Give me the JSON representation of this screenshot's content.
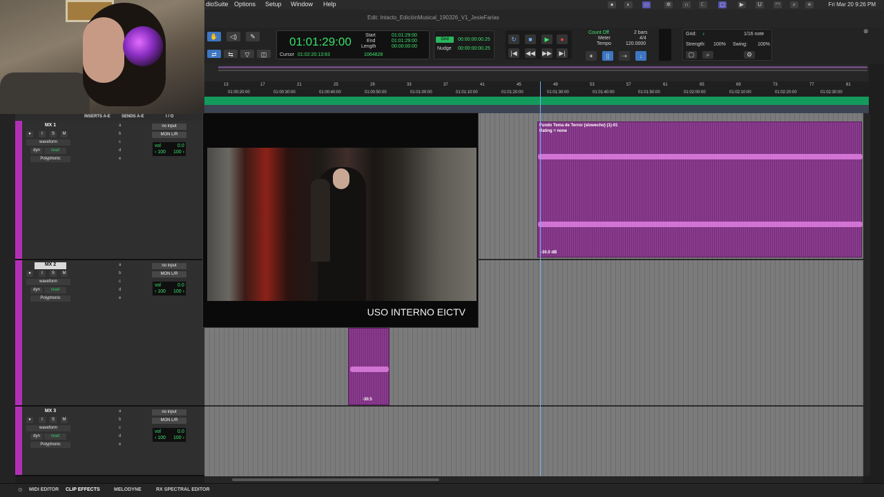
{
  "menubar": {
    "items": [
      "dioSuite",
      "Options",
      "Setup",
      "Window",
      "Help"
    ],
    "clock": "Fri Mar 20  9:26 PM"
  },
  "window": {
    "title": "Edit: Intacto_EdiciónMusical_190326_V1_JesieFarias"
  },
  "counter": {
    "main": "01:01:29:00",
    "start_label": "Start",
    "end_label": "End",
    "length_label": "Length",
    "start": "01:01:29:00",
    "end": "01:01:29:00",
    "length": "00:00:00:00",
    "cursor_label": "Cursor",
    "cursor": "01:02:20:13:93",
    "samples": "1064828",
    "grid_label": "Grid",
    "grid_value": "00:00:00:00.25",
    "nudge_label": "Nudge",
    "nudge_value": "00:00:00:00.25"
  },
  "count": {
    "count_off": "Count Off",
    "meter_label": "Meter",
    "tempo_label": "Tempo",
    "bars": "2 bars",
    "meter": "4/4",
    "tempo": "120.0000"
  },
  "gridpanel": {
    "grid_label": "Grid:",
    "grid_note": "1/16 note",
    "strength_label": "Strength:",
    "strength": "100%",
    "swing_label": "Swing:",
    "swing": "100%"
  },
  "ruler": {
    "bars": [
      "13",
      "17",
      "21",
      "25",
      "29",
      "33",
      "37",
      "41",
      "45",
      "49",
      "53",
      "57",
      "61",
      "65",
      "69",
      "73",
      "77",
      "81"
    ],
    "timecodes": [
      "01:00:20:00",
      "01:00:30:00",
      "01:00:40:00",
      "01:00:50:00",
      "01:01:00:00",
      "01:01:10:00",
      "01:01:20:00",
      "01:01:30:00",
      "01:01:40:00",
      "01:01:50:00",
      "01:02:00:00",
      "01:02:10:00",
      "01:02:20:00",
      "01:02:30:00"
    ]
  },
  "mixer_header": {
    "inserts": "INSERTS A-E",
    "sends": "SENDS A-E",
    "io": "I / O"
  },
  "tracks": [
    {
      "name": "MX 1",
      "view": "waveform",
      "dyn": "dyn",
      "mode": "read",
      "voice": "Polyphonic",
      "input": "no input",
      "output": "MON L/R",
      "vol_label": "vol",
      "vol": "0.0",
      "pan_l": "‹ 100",
      "pan_r": "100 ›"
    },
    {
      "name": "MX 2",
      "view": "waveform",
      "dyn": "dyn",
      "mode": "read",
      "voice": "Polyphonic",
      "input": "no input",
      "output": "MON L/R",
      "vol_label": "vol",
      "vol": "0.0",
      "pan_l": "‹ 100",
      "pan_r": "100 ›"
    },
    {
      "name": "MX 3",
      "view": "waveform",
      "dyn": "dyn",
      "mode": "read",
      "voice": "Polyphonic",
      "input": "no input",
      "output": "MON L/R",
      "vol_label": "vol",
      "vol": "0.0",
      "pan_l": "‹ 100",
      "pan_r": "100 ›"
    }
  ],
  "solo_labels": {
    "i": "I",
    "s": "S",
    "m": "M"
  },
  "insert_letters": [
    "a",
    "b",
    "c",
    "d",
    "e"
  ],
  "clips": {
    "main_name": "Fundo Tema de Terror (slowecho) (1)-01",
    "main_rating": "Rating = none",
    "main_gain": "-30.0 dB",
    "small_gain": "-30.5"
  },
  "video": {
    "caption": "USO INTERNO EICTV"
  },
  "bottom_tabs": [
    "MIDI EDITOR",
    "CLIP EFFECTS",
    "MELODYNE",
    "RX SPECTRAL EDITOR"
  ],
  "colors": {
    "track": "#b12fb6",
    "clip": "#8b3a8f",
    "waveform": "#d677d8",
    "counter_text": "#36e06a",
    "ruler_green": "#139a5c"
  }
}
